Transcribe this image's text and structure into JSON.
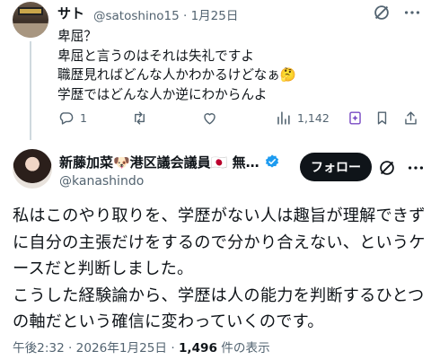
{
  "reply_tweet": {
    "author_name": "サト",
    "author_meta": "@satoshino15 · 1月25日",
    "avatar_text": "",
    "lines": [
      "卑屈？",
      "卑屈と言うのはそれは失礼ですよ",
      "職歴見ればどんな人かわかるけどなぁ🤔",
      "学歴ではどんな人か逆にわからんよ"
    ],
    "actions": {
      "reply_count": "1",
      "retweet_count": "",
      "like_count": "",
      "views_count": "1,142"
    }
  },
  "main_tweet": {
    "author_name": "新藤加菜🐶港区議会議員🇯🇵 無…",
    "author_handle": "@kanashindo",
    "follow_label": "フォロー",
    "lines": [
      "私はこのやり取りを、学歴がない人は趣旨が理解できず",
      "に自分の主張だけをするので分かり合えない、というケ",
      "ースだと判断しました。",
      "こうした経験論から、学歴は人の能力を判断するひとつ",
      "の軸だという確信に変わっていくのです。"
    ],
    "timestamp": "午後2:32 · 2026年1月25日 · ",
    "views_value": "1,496",
    "views_suffix": " 件の表示"
  },
  "colors": {
    "text": "#0f1419",
    "secondary": "#536471",
    "verified": "#1d9bf0",
    "grok": "#794bc4"
  },
  "icons": [
    "grok-icon",
    "more-icon",
    "reply-icon",
    "retweet-icon",
    "like-icon",
    "views-icon",
    "grok-icon",
    "bookmark-icon",
    "share-icon",
    "verified-badge-icon"
  ]
}
